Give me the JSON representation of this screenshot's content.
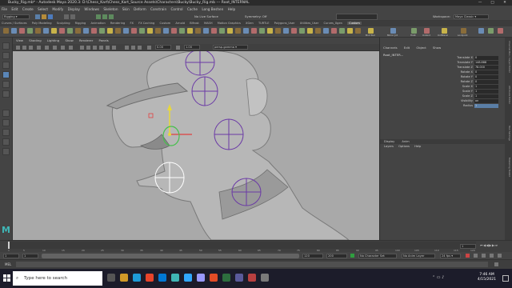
{
  "window": {
    "title": "Bucky_Rig.mb* - Autodesk Maya 2020.3: D:\\Chess_Kart\\Chess_Kart_Source Assets\\Characters\\Bucky\\Bucky_Rig.mb --- Root_INTERNAL",
    "minimize": "—",
    "maximize": "□",
    "close": "✕"
  },
  "menubar": {
    "items": [
      "File",
      "Edit",
      "Create",
      "Select",
      "Modify",
      "Display",
      "Windows",
      "Skeleton",
      "Skin",
      "Deform",
      "Constrain",
      "Control",
      "Cache",
      "Long Beshen",
      "Help"
    ]
  },
  "statusline": {
    "mode": "Rigging",
    "no_live_surface": "No Live Surface",
    "symmetry": "Symmetry: Off",
    "workspace_label": "Workspace:",
    "workspace": "Maya Classic"
  },
  "shelf": {
    "tabs": [
      "Curves / Surfaces",
      "Poly Modeling",
      "Sculpting",
      "Rigging",
      "Animation",
      "Rendering",
      "FX",
      "FX Caching",
      "Custom",
      "Arnold",
      "Bifrost",
      "MASH",
      "Motion Graphics",
      "XGen",
      "TURTLE",
      "Polygons_User",
      "Utilities_User",
      "Curves_Xgen",
      "Custom"
    ],
    "active_tab": "Custom",
    "labels": [
      "Bnd Tool",
      "Mirror Jnt",
      "HiAK",
      "Unbind",
      "Unfilteral",
      "Lockjoint"
    ]
  },
  "panel": {
    "menu": [
      "View",
      "Shading",
      "Lighting",
      "Show",
      "Renderer",
      "Panels"
    ],
    "camera_field": "persp.gamma"
  },
  "channelbox": {
    "menu": [
      "Channels",
      "Edit",
      "Object",
      "Show"
    ],
    "object": "Root_INTER...",
    "attributes": [
      {
        "label": "Translate X",
        "value": "0"
      },
      {
        "label": "Translate Y",
        "value": "148.888"
      },
      {
        "label": "Translate Z",
        "value": "78.000"
      },
      {
        "label": "Rotate X",
        "value": "0"
      },
      {
        "label": "Rotate Y",
        "value": "0"
      },
      {
        "label": "Rotate Z",
        "value": "0"
      },
      {
        "label": "Scale X",
        "value": "1"
      },
      {
        "label": "Scale Y",
        "value": "1"
      },
      {
        "label": "Scale Z",
        "value": "1"
      },
      {
        "label": "Visibility",
        "value": "on"
      },
      {
        "label": "Radius",
        "value": "1"
      }
    ]
  },
  "layers": {
    "tabs": [
      "Display",
      "Anim"
    ],
    "menu": [
      "Layers",
      "Options",
      "Help"
    ]
  },
  "sidetabs": [
    "Channel Box / Layer Editor",
    "Attribute Editor",
    "Tool Settings",
    "Modeling Toolkit"
  ],
  "timeline": {
    "ticks": [
      "1",
      "5",
      "10",
      "15",
      "20",
      "25",
      "30",
      "35",
      "40",
      "45",
      "50",
      "55",
      "60",
      "65",
      "70",
      "75",
      "80",
      "85",
      "90",
      "95",
      "100",
      "105",
      "110",
      "115",
      "120"
    ],
    "current_frame": "1",
    "range_start": "1",
    "range_inner_start": "1",
    "range_inner_end": "120",
    "range_end": "200",
    "no_character_set": "No Character Set",
    "no_anim_layer": "No Anim Layer",
    "fps": "24 fps"
  },
  "cmdline": {
    "lang": "MEL"
  },
  "taskbar": {
    "search_placeholder": "Type here to search",
    "time": "7:46 AM",
    "date": "4/15/2021"
  }
}
